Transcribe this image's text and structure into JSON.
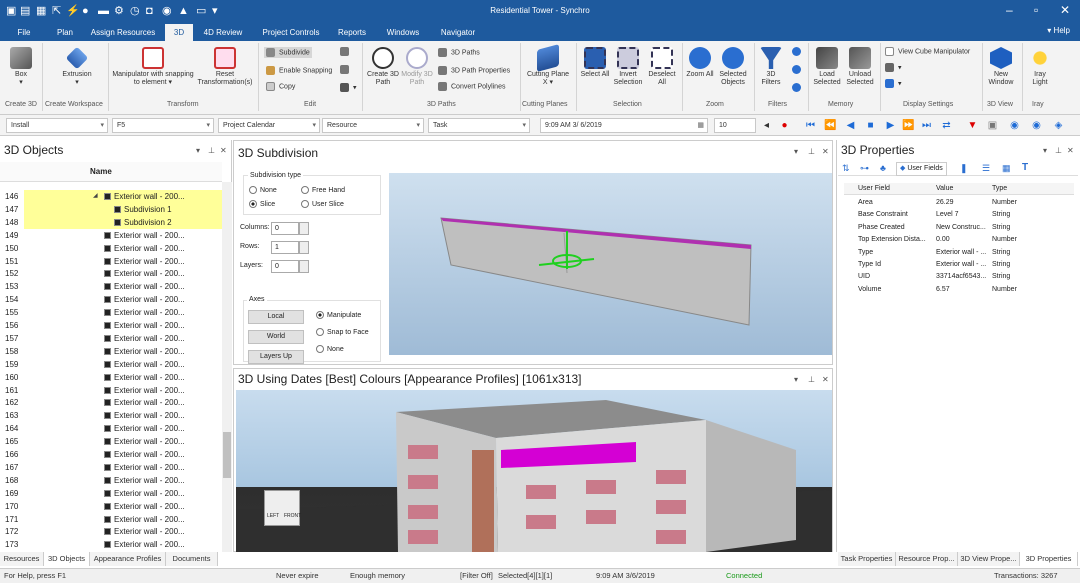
{
  "window": {
    "title": "Residential Tower - Synchro",
    "help": "Help"
  },
  "menu": [
    "File",
    "Plan",
    "Assign Resources",
    "3D",
    "4D Review",
    "Project Controls",
    "Reports",
    "Windows",
    "Navigator"
  ],
  "ribbon": {
    "create3d": {
      "box": "Box",
      "group": "Create 3D"
    },
    "workspace": {
      "extrusion": "Extrusion",
      "group": "Create Workspace"
    },
    "transform": {
      "manipulator": "Manipulator with snapping to element",
      "reset": "Reset Transformation(s)",
      "group": "Transform"
    },
    "edit": {
      "subdivide": "Subdivide",
      "snapping": "Enable Snapping",
      "copy": "Copy",
      "group": "Edit"
    },
    "paths": {
      "create": "Create 3D Path",
      "modify": "Modify 3D Path",
      "paths": "3D Paths",
      "props": "3D Path Properties",
      "convert": "Convert Polylines",
      "group": "3D Paths"
    },
    "cutting": {
      "plane": "Cutting Plane X",
      "group": "Cutting Planes"
    },
    "selection": {
      "all": "Select All",
      "invert": "Invert Selection",
      "deselect": "Deselect All",
      "group": "Selection"
    },
    "zoom": {
      "all": "Zoom All",
      "selected": "Selected Objects",
      "group": "Zoom"
    },
    "filters": {
      "filters": "3D Filters",
      "group": "Filters"
    },
    "memory": {
      "load": "Load Selected",
      "unload": "Unload Selected",
      "group": "Memory"
    },
    "display": {
      "viewcube": "View Cube Manipulator",
      "group": "Display Settings"
    },
    "view": {
      "newwin": "New Window",
      "group": "3D View"
    },
    "iray": {
      "light": "Iray Light",
      "group": "Iray"
    }
  },
  "toolbar2": {
    "install": "Install",
    "f5": "F5",
    "calendar": "Project Calendar",
    "resource": "Resource",
    "task": "Task",
    "datetime": "9:09 AM  3/  6/2019",
    "zoomval": "10"
  },
  "objects": {
    "title": "3D Objects",
    "col_name": "Name",
    "rows": [
      {
        "n": "146",
        "label": "Exterior wall - 200...",
        "indent": 1
      },
      {
        "n": "147",
        "label": "Subdivision 1",
        "indent": 2
      },
      {
        "n": "148",
        "label": "Subdivision 2",
        "indent": 2
      },
      {
        "n": "149",
        "label": "Exterior wall - 200...",
        "indent": 0
      },
      {
        "n": "150",
        "label": "Exterior wall - 200...",
        "indent": 0
      },
      {
        "n": "151",
        "label": "Exterior wall - 200...",
        "indent": 0
      },
      {
        "n": "152",
        "label": "Exterior wall - 200...",
        "indent": 0
      },
      {
        "n": "153",
        "label": "Exterior wall - 200...",
        "indent": 0
      },
      {
        "n": "154",
        "label": "Exterior wall - 200...",
        "indent": 0
      },
      {
        "n": "155",
        "label": "Exterior wall - 200...",
        "indent": 0
      },
      {
        "n": "156",
        "label": "Exterior wall - 200...",
        "indent": 0
      },
      {
        "n": "157",
        "label": "Exterior wall - 200...",
        "indent": 0
      },
      {
        "n": "158",
        "label": "Exterior wall - 200...",
        "indent": 0
      },
      {
        "n": "159",
        "label": "Exterior wall - 200...",
        "indent": 0
      },
      {
        "n": "160",
        "label": "Exterior wall - 200...",
        "indent": 0
      },
      {
        "n": "161",
        "label": "Exterior wall - 200...",
        "indent": 0
      },
      {
        "n": "162",
        "label": "Exterior wall - 200...",
        "indent": 0
      },
      {
        "n": "163",
        "label": "Exterior wall - 200...",
        "indent": 0
      },
      {
        "n": "164",
        "label": "Exterior wall - 200...",
        "indent": 0
      },
      {
        "n": "165",
        "label": "Exterior wall - 200...",
        "indent": 0
      },
      {
        "n": "166",
        "label": "Exterior wall - 200...",
        "indent": 0
      },
      {
        "n": "167",
        "label": "Exterior wall - 200...",
        "indent": 0
      },
      {
        "n": "168",
        "label": "Exterior wall - 200...",
        "indent": 0
      },
      {
        "n": "169",
        "label": "Exterior wall - 200...",
        "indent": 0
      },
      {
        "n": "170",
        "label": "Exterior wall - 200...",
        "indent": 0
      },
      {
        "n": "171",
        "label": "Exterior wall - 200...",
        "indent": 0
      },
      {
        "n": "172",
        "label": "Exterior wall - 200...",
        "indent": 0
      },
      {
        "n": "173",
        "label": "Exterior wall - 200...",
        "indent": 0
      }
    ],
    "tabs": [
      "Resources",
      "3D Objects",
      "Appearance Profiles",
      "Documents"
    ]
  },
  "subdivision": {
    "title": "3D Subdivision",
    "type_label": "Subdivision type",
    "none": "None",
    "freehand": "Free Hand",
    "slice": "Slice",
    "userslice": "User Slice",
    "columns": "Columns:",
    "rows": "Rows:",
    "layers": "Layers:",
    "colval": "0",
    "rowval": "1",
    "layval": "0",
    "axes": "Axes",
    "local": "Local",
    "world": "World",
    "layersup": "Layers Up",
    "manipulate": "Manipulate",
    "snap": "Snap to Face",
    "anone": "None"
  },
  "dates": {
    "title": "3D Using Dates [Best] Colours [Appearance Profiles] [1061x313]",
    "cube_left": "LEFT",
    "cube_front": "FRONT"
  },
  "props": {
    "title": "3D Properties",
    "tab_user": "User Fields",
    "headers": [
      "User Field",
      "Value",
      "Type"
    ],
    "rows": [
      [
        "Area",
        "26.29",
        "Number"
      ],
      [
        "Base Constraint",
        "Level 7",
        "String"
      ],
      [
        "Phase Created",
        "New Construc...",
        "String"
      ],
      [
        "Top Extension Dista...",
        "0.00",
        "Number"
      ],
      [
        "Type",
        "Exterior wall - ...",
        "String"
      ],
      [
        "Type Id",
        "Exterior wall - ...",
        "String"
      ],
      [
        "UID",
        "33714acf6543...",
        "String"
      ],
      [
        "Volume",
        "6.57",
        "Number"
      ]
    ],
    "tabs": [
      "Task Properties",
      "Resource Prop...",
      "3D View Prope...",
      "3D Properties"
    ]
  },
  "status": {
    "help": "For Help, press F1",
    "expire": "Never expire",
    "memory": "Enough memory",
    "filter": "[Filter Off]",
    "selected": "Selected[4][1][1]",
    "time": "9:09 AM 3/6/2019",
    "connected": "Connected",
    "transactions": "Transactions: 3267"
  }
}
